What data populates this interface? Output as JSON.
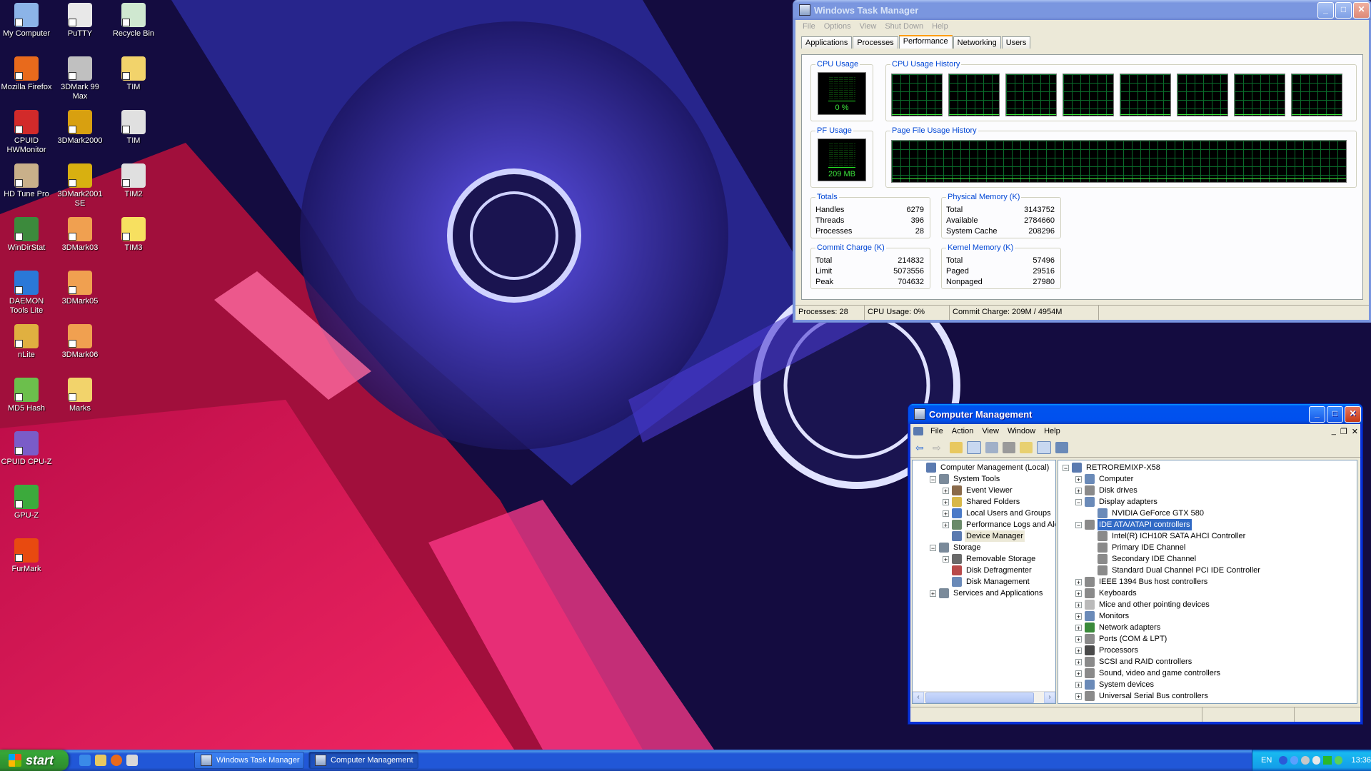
{
  "desktop_icons": [
    {
      "label": "My Computer",
      "color": "#8cb4e8"
    },
    {
      "label": "PuTTY",
      "color": "#e8e8e8"
    },
    {
      "label": "Recycle Bin",
      "color": "#cfe8d0"
    },
    {
      "label": "Mozilla Firefox",
      "color": "#e86a1c"
    },
    {
      "label": "3DMark 99 Max",
      "color": "#c0c0c0"
    },
    {
      "label": "TIM",
      "color": "#f2d36b"
    },
    {
      "label": "CPUID HWMonitor",
      "color": "#d22a2a"
    },
    {
      "label": "3DMark2000",
      "color": "#d8a010"
    },
    {
      "label": "TIM",
      "color": "#e0e0e0"
    },
    {
      "label": "HD Tune Pro",
      "color": "#c9b08a"
    },
    {
      "label": "3DMark2001 SE",
      "color": "#d8b010"
    },
    {
      "label": "TIM2",
      "color": "#e0e0e0"
    },
    {
      "label": "WinDirStat",
      "color": "#3c8a3c"
    },
    {
      "label": "3DMark03",
      "color": "#f0a050"
    },
    {
      "label": "TIM3",
      "color": "#f7e060"
    },
    {
      "label": "DAEMON Tools Lite",
      "color": "#2a78d8"
    },
    {
      "label": "3DMark05",
      "color": "#f0a050"
    },
    {
      "label": "nLite",
      "color": "#e0b040"
    },
    {
      "label": "3DMark06",
      "color": "#f0a050"
    },
    {
      "label": "MD5 Hash",
      "color": "#6cbf4c"
    },
    {
      "label": "Marks",
      "color": "#f2d36b"
    },
    {
      "label": "CPUID CPU-Z",
      "color": "#7a5cc8"
    },
    {
      "label": "GPU-Z",
      "color": "#3caa3c"
    },
    {
      "label": "FurMark",
      "color": "#e84a10"
    }
  ],
  "task_manager": {
    "title": "Windows Task Manager",
    "menu": [
      "File",
      "Options",
      "View",
      "Shut Down",
      "Help"
    ],
    "tabs": [
      "Applications",
      "Processes",
      "Performance",
      "Networking",
      "Users"
    ],
    "active_tab": "Performance",
    "cpu_usage": {
      "label": "CPU Usage",
      "value": "0 %",
      "level": 0
    },
    "cpu_history": {
      "label": "CPU Usage History",
      "cores": 8
    },
    "pf_usage": {
      "label": "PF Usage",
      "value": "209 MB",
      "level": 0.04
    },
    "pf_history": {
      "label": "Page File Usage History"
    },
    "totals": {
      "label": "Totals",
      "rows": [
        [
          "Handles",
          "6279"
        ],
        [
          "Threads",
          "396"
        ],
        [
          "Processes",
          "28"
        ]
      ]
    },
    "physical_memory": {
      "label": "Physical Memory (K)",
      "rows": [
        [
          "Total",
          "3143752"
        ],
        [
          "Available",
          "2784660"
        ],
        [
          "System Cache",
          "208296"
        ]
      ]
    },
    "commit_charge": {
      "label": "Commit Charge (K)",
      "rows": [
        [
          "Total",
          "214832"
        ],
        [
          "Limit",
          "5073556"
        ],
        [
          "Peak",
          "704632"
        ]
      ]
    },
    "kernel_memory": {
      "label": "Kernel Memory (K)",
      "rows": [
        [
          "Total",
          "57496"
        ],
        [
          "Paged",
          "29516"
        ],
        [
          "Nonpaged",
          "27980"
        ]
      ]
    },
    "status": {
      "processes": "Processes: 28",
      "cpu": "CPU Usage: 0%",
      "commit": "Commit Charge: 209M / 4954M"
    }
  },
  "computer_management": {
    "title": "Computer Management",
    "menu": [
      "File",
      "Action",
      "View",
      "Window",
      "Help"
    ],
    "left_tree": [
      {
        "label": "Computer Management (Local)",
        "indent": 0,
        "exp": "",
        "color": "#5a7ab0"
      },
      {
        "label": "System Tools",
        "indent": 1,
        "exp": "−",
        "color": "#7a8a9a"
      },
      {
        "label": "Event Viewer",
        "indent": 2,
        "exp": "+",
        "color": "#8a6a4a"
      },
      {
        "label": "Shared Folders",
        "indent": 2,
        "exp": "+",
        "color": "#d8b84a"
      },
      {
        "label": "Local Users and Groups",
        "indent": 2,
        "exp": "+",
        "color": "#4a7ac8"
      },
      {
        "label": "Performance Logs and Alerts",
        "indent": 2,
        "exp": "+",
        "color": "#6a8a6a"
      },
      {
        "label": "Device Manager",
        "indent": 2,
        "exp": "",
        "color": "#5a7ab0",
        "focus": true
      },
      {
        "label": "Storage",
        "indent": 1,
        "exp": "−",
        "color": "#7a8a9a"
      },
      {
        "label": "Removable Storage",
        "indent": 2,
        "exp": "+",
        "color": "#6a6a6a"
      },
      {
        "label": "Disk Defragmenter",
        "indent": 2,
        "exp": "",
        "color": "#b84a4a"
      },
      {
        "label": "Disk Management",
        "indent": 2,
        "exp": "",
        "color": "#6a8ab8"
      },
      {
        "label": "Services and Applications",
        "indent": 1,
        "exp": "+",
        "color": "#7a8a9a"
      }
    ],
    "right_tree": [
      {
        "label": "RETROREMIXP-X58",
        "indent": 0,
        "exp": "−",
        "color": "#5a7ab0"
      },
      {
        "label": "Computer",
        "indent": 1,
        "exp": "+",
        "color": "#6a8ab8"
      },
      {
        "label": "Disk drives",
        "indent": 1,
        "exp": "+",
        "color": "#8a8a8a"
      },
      {
        "label": "Display adapters",
        "indent": 1,
        "exp": "−",
        "color": "#6a8ab8"
      },
      {
        "label": "NVIDIA GeForce GTX 580",
        "indent": 2,
        "exp": "",
        "color": "#6a8ab8"
      },
      {
        "label": "IDE ATA/ATAPI controllers",
        "indent": 1,
        "exp": "−",
        "color": "#8a8a8a",
        "selected": true
      },
      {
        "label": "Intel(R) ICH10R SATA AHCI Controller",
        "indent": 2,
        "exp": "",
        "color": "#8a8a8a"
      },
      {
        "label": "Primary IDE Channel",
        "indent": 2,
        "exp": "",
        "color": "#8a8a8a"
      },
      {
        "label": "Secondary IDE Channel",
        "indent": 2,
        "exp": "",
        "color": "#8a8a8a"
      },
      {
        "label": "Standard Dual Channel PCI IDE Controller",
        "indent": 2,
        "exp": "",
        "color": "#8a8a8a"
      },
      {
        "label": "IEEE 1394 Bus host controllers",
        "indent": 1,
        "exp": "+",
        "color": "#8a8a8a"
      },
      {
        "label": "Keyboards",
        "indent": 1,
        "exp": "+",
        "color": "#8a8a8a"
      },
      {
        "label": "Mice and other pointing devices",
        "indent": 1,
        "exp": "+",
        "color": "#bababa"
      },
      {
        "label": "Monitors",
        "indent": 1,
        "exp": "+",
        "color": "#6a8ab8"
      },
      {
        "label": "Network adapters",
        "indent": 1,
        "exp": "+",
        "color": "#3a8a3a"
      },
      {
        "label": "Ports (COM & LPT)",
        "indent": 1,
        "exp": "+",
        "color": "#8a8a8a"
      },
      {
        "label": "Processors",
        "indent": 1,
        "exp": "+",
        "color": "#4a4a4a"
      },
      {
        "label": "SCSI and RAID controllers",
        "indent": 1,
        "exp": "+",
        "color": "#8a8a8a"
      },
      {
        "label": "Sound, video and game controllers",
        "indent": 1,
        "exp": "+",
        "color": "#8a8a8a"
      },
      {
        "label": "System devices",
        "indent": 1,
        "exp": "+",
        "color": "#6a8ab8"
      },
      {
        "label": "Universal Serial Bus controllers",
        "indent": 1,
        "exp": "+",
        "color": "#8a8a8a"
      }
    ]
  },
  "taskbar": {
    "start_label": "start",
    "tasks": [
      "Windows Task Manager",
      "Computer Management"
    ],
    "active_task": "Computer Management",
    "language": "EN",
    "clock": "13:36"
  }
}
